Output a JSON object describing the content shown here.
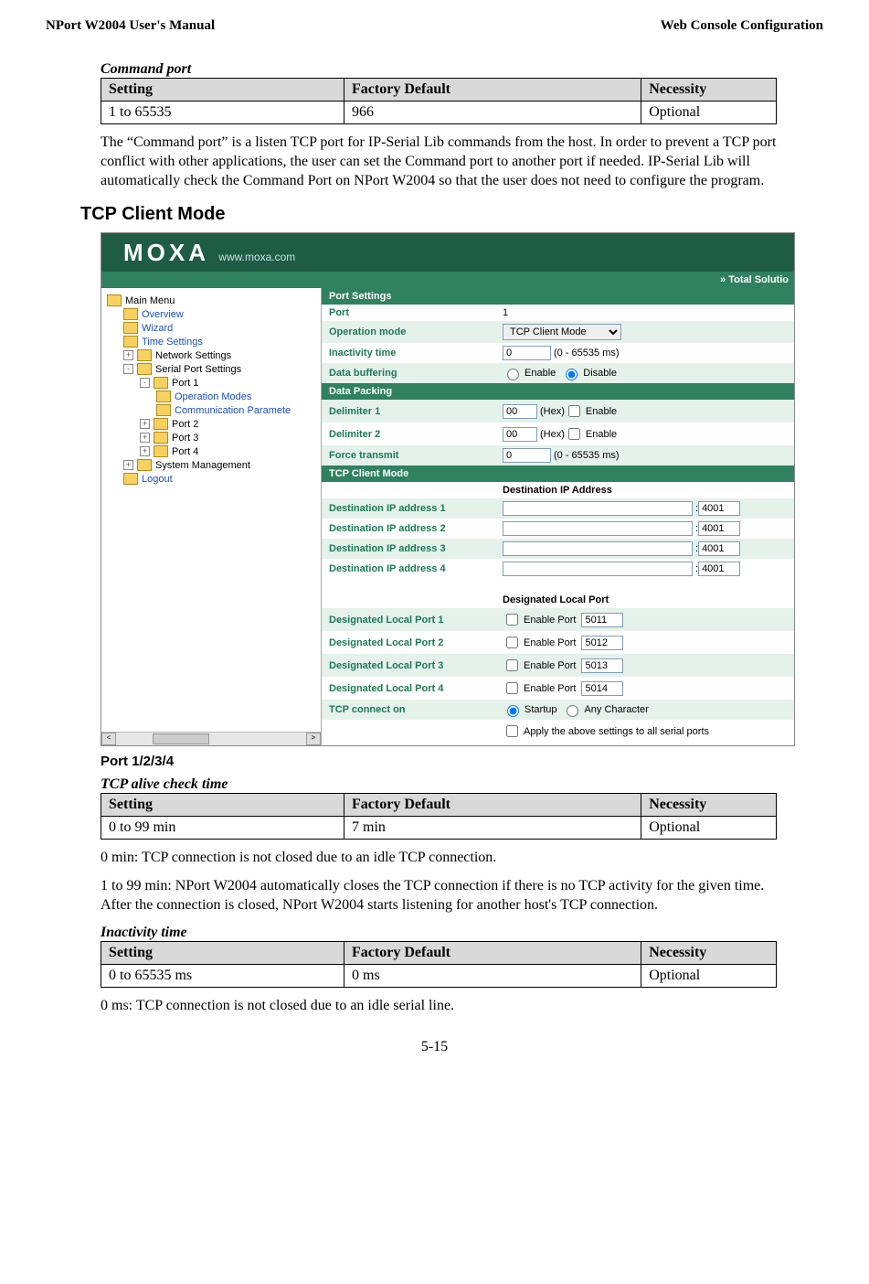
{
  "header": {
    "left": "NPort W2004 User's Manual",
    "right": "Web Console Configuration"
  },
  "cmdport": {
    "title": "Command port",
    "th": [
      "Setting",
      "Factory Default",
      "Necessity"
    ],
    "row": [
      "1 to 65535",
      "966",
      "Optional"
    ]
  },
  "cmdport_text": "The “Command port” is a listen TCP port for IP-Serial Lib commands from the host. In order to prevent a TCP port conflict with other applications, the user can set the Command port to another port if needed. IP-Serial Lib will automatically check the Command Port on NPort W2004 so that the user does not need to configure the program.",
  "tcpclient_title": "TCP Client Mode",
  "port_heading": "Port 1/2/3/4",
  "tcp_alive": {
    "title": "TCP alive check time",
    "th": [
      "Setting",
      "Factory Default",
      "Necessity"
    ],
    "row": [
      "0 to 99 min",
      "7 min",
      "Optional"
    ]
  },
  "alive_p1": "0 min: TCP connection is not closed due to an idle TCP connection.",
  "alive_p2": "1 to 99 min: NPort W2004 automatically closes the TCP connection if there is no TCP activity for the given time. After the connection is closed, NPort W2004 starts listening for another host's TCP connection.",
  "inactivity": {
    "title": "Inactivity time",
    "th": [
      "Setting",
      "Factory Default",
      "Necessity"
    ],
    "row": [
      "0 to 65535 ms",
      "0 ms",
      "Optional"
    ]
  },
  "inact_text": "0 ms: TCP connection is not closed due to an idle serial line.",
  "page": "5-15",
  "shot": {
    "moxa": "MOXA",
    "moxa_url": "www.moxa.com",
    "subbanner": "»  Total Solutio",
    "tree": {
      "main": "Main Menu",
      "overview": "Overview",
      "wizard": "Wizard",
      "time": "Time Settings",
      "network": "Network Settings",
      "serial": "Serial Port Settings",
      "port1": "Port 1",
      "opmodes": "Operation Modes",
      "commparam": "Communication Paramete",
      "port2": "Port 2",
      "port3": "Port 3",
      "port4": "Port 4",
      "sysmgmt": "System Management",
      "logout": "Logout"
    },
    "config": {
      "port_settings": "Port Settings",
      "port": "Port",
      "port_val": "1",
      "opmode": "Operation mode",
      "opmode_val": "TCP Client Mode",
      "inactivity": "Inactivity time",
      "inactivity_val": "0",
      "inactivity_hint": "(0 - 65535 ms)",
      "databuf": "Data buffering",
      "enable": "Enable",
      "disable": "Disable",
      "datapack": "Data Packing",
      "delim1": "Delimiter 1",
      "delim1_val": "00",
      "delim2": "Delimiter 2",
      "delim2_val": "00",
      "hex": "(Hex)",
      "force": "Force transmit",
      "force_val": "0",
      "force_hint": "(0 - 65535 ms)",
      "tcpclient": "TCP Client Mode",
      "dest_ip_hdr": "Destination IP Address",
      "dest1": "Destination IP address 1",
      "dest2": "Destination IP address 2",
      "dest3": "Destination IP address 3",
      "dest4": "Destination IP address 4",
      "port4001": "4001",
      "local_hdr": "Designated Local Port",
      "loc1": "Designated Local Port 1",
      "loc1_val": "5011",
      "loc2": "Designated Local Port 2",
      "loc2_val": "5012",
      "loc3": "Designated Local Port 3",
      "loc3_val": "5013",
      "loc4": "Designated Local Port 4",
      "loc4_val": "5014",
      "enable_port": "Enable Port",
      "connect_on": "TCP connect on",
      "startup": "Startup",
      "anychar": "Any Character",
      "apply_all": "Apply the above settings to all serial ports"
    }
  }
}
